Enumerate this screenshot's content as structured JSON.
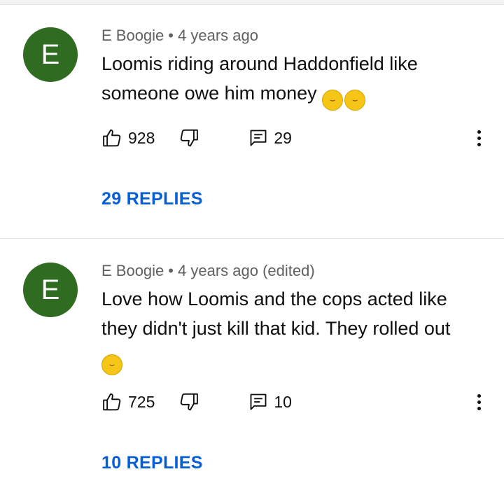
{
  "comments": [
    {
      "avatar_letter": "E",
      "author": "E Boogie",
      "separator": "•",
      "time": "4 years ago",
      "line1": "Loomis riding around Haddonfield like",
      "line2": "someone owe him money",
      "emoji_icon": "face-with-tears-of-joy-icon",
      "likes": "928",
      "reply_count": "29",
      "replies_label": "29 REPLIES"
    },
    {
      "avatar_letter": "E",
      "author": "E Boogie",
      "separator": "•",
      "time": "4 years ago (edited)",
      "line1": "Love how Loomis and the cops acted like",
      "line2": "they didn't just kill that kid. They rolled out",
      "emoji_icon": "face-with-tears-of-joy-icon",
      "likes": "725",
      "reply_count": "10",
      "replies_label": "10 REPLIES"
    }
  ],
  "colors": {
    "avatar_bg": "#2f6b20",
    "link_blue": "#065fd4",
    "meta_gray": "#606060"
  }
}
